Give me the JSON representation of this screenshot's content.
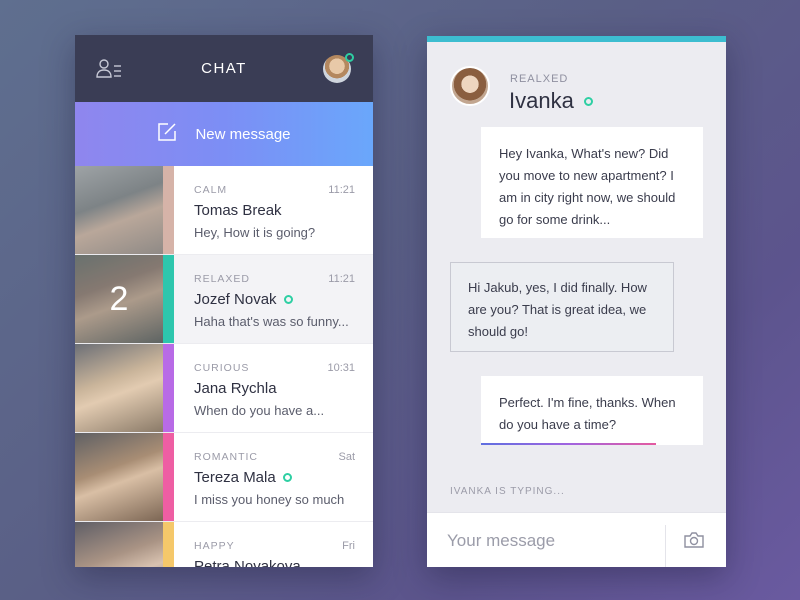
{
  "header": {
    "title": "CHAT"
  },
  "new_message": {
    "label": "New message"
  },
  "conversations": [
    {
      "mood": "CALM",
      "time": "11:21",
      "name": "Tomas Break",
      "preview": "Hey, How it is going?",
      "mood_color": "#d6b3a8",
      "online": false,
      "unread": ""
    },
    {
      "mood": "RELAXED",
      "time": "11:21",
      "name": "Jozef Novak",
      "preview": "Haha that's was so funny...",
      "mood_color": "#2dc6ad",
      "online": true,
      "unread": "2"
    },
    {
      "mood": "CURIOUS",
      "time": "10:31",
      "name": "Jana Rychla",
      "preview": "When do you have a...",
      "mood_color": "#b86be6",
      "online": false,
      "unread": ""
    },
    {
      "mood": "ROMANTIC",
      "time": "Sat",
      "name": "Tereza Mala",
      "preview": "I miss you honey so much",
      "mood_color": "#ee5ea3",
      "online": true,
      "unread": ""
    },
    {
      "mood": "HAPPY",
      "time": "Fri",
      "name": "Petra Novakova",
      "preview": "",
      "mood_color": "#f5c86a",
      "online": false,
      "unread": ""
    }
  ],
  "chat": {
    "contact_mood": "REALXED",
    "contact_name": "Ivanka",
    "messages": [
      {
        "direction": "out",
        "text": "Hey Ivanka, What's new? Did you move to new apartment? I am in city right now, we should go for some drink..."
      },
      {
        "direction": "in",
        "text": "Hi Jakub, yes, I did finally. How are you? That is great idea, we should go!"
      },
      {
        "direction": "out",
        "text": "Perfect. I'm fine, thanks. When do you have a time?"
      }
    ],
    "typing_status": "IVANKA IS TYPING...",
    "composer_placeholder": "Your message"
  },
  "colors": {
    "header_bg": "#3a3d55",
    "new_message_gradient": [
      "#8f86ee",
      "#6aa7fb"
    ],
    "online": "#2ecfa3",
    "chat_top_line": "#3dbdd0"
  },
  "icons": {
    "contacts": "contacts-list-icon",
    "compose": "compose-icon",
    "camera": "camera-icon"
  }
}
